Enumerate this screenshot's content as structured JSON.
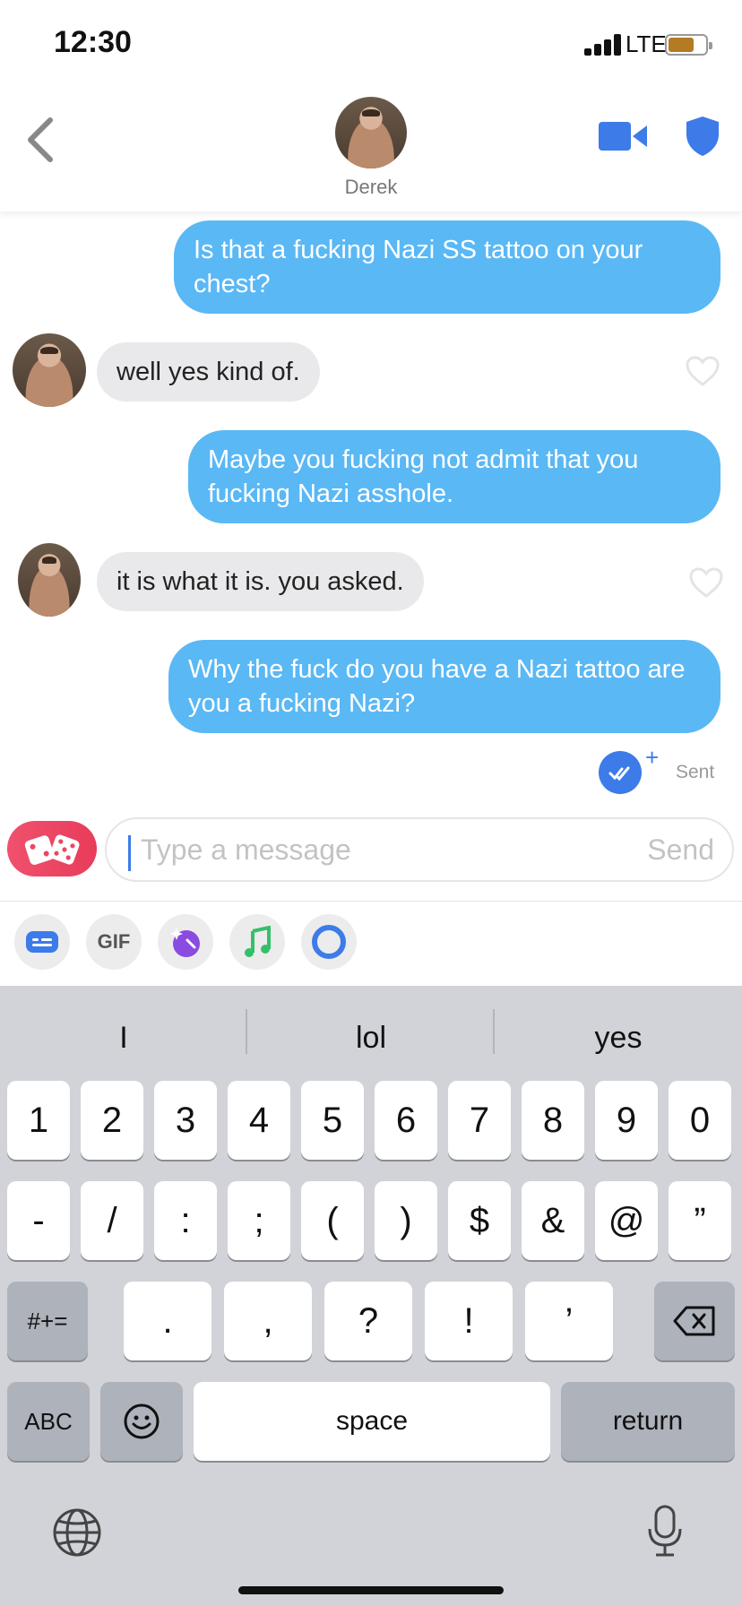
{
  "status": {
    "time": "12:30",
    "network": "LTE"
  },
  "header": {
    "name": "Derek"
  },
  "messages": [
    {
      "dir": "out",
      "text": "Is that a fucking Nazi SS tattoo on your chest?"
    },
    {
      "dir": "in",
      "text": "well yes kind of."
    },
    {
      "dir": "out",
      "text": "Maybe you fucking not admit that you fucking Nazi asshole."
    },
    {
      "dir": "in",
      "text": "it is what it is. you asked."
    },
    {
      "dir": "out",
      "text": "Why the fuck do you have a Nazi tattoo are you a fucking Nazi?"
    }
  ],
  "receipt": {
    "status": "Sent",
    "plus": "+"
  },
  "composer": {
    "placeholder": "Type a message",
    "send": "Send"
  },
  "attachments": {
    "gif": "GIF"
  },
  "keyboard": {
    "suggestions": [
      "I",
      "lol",
      "yes"
    ],
    "row1": [
      "1",
      "2",
      "3",
      "4",
      "5",
      "6",
      "7",
      "8",
      "9",
      "0"
    ],
    "row2": [
      "-",
      "/",
      ":",
      ";",
      "(",
      ")",
      "$",
      "&",
      "@",
      "”"
    ],
    "row3_mode": "#+=",
    "row3": [
      ".",
      ",",
      "?",
      "!",
      "’"
    ],
    "abc": "ABC",
    "space": "space",
    "return": "return"
  },
  "icons": {
    "back": "chevron-left-icon",
    "video": "video-camera-icon",
    "shield": "shield-icon",
    "dice": "dice-icon",
    "heart": "heart-outline-icon",
    "delete": "backspace-icon",
    "emoji": "emoji-icon",
    "globe": "globe-icon",
    "mic": "microphone-icon"
  },
  "colors": {
    "accent": "#3d7be8",
    "bubble_out": "#5ab8f5",
    "bubble_in": "#e9e9eb",
    "dice": "#ec4662"
  }
}
